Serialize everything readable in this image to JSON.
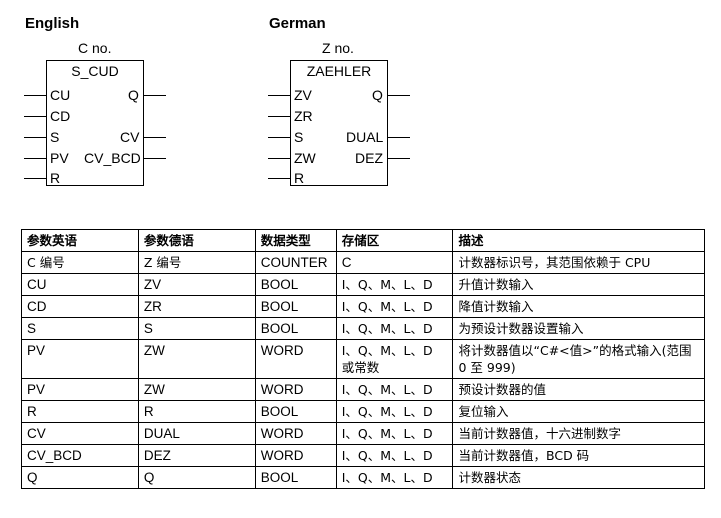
{
  "english": {
    "heading": "English",
    "cno": "C no.",
    "block_title": "S_CUD",
    "left_pins": [
      "CU",
      "CD",
      "S",
      "PV",
      "R"
    ],
    "right_pins": [
      "Q",
      "CV",
      "CV_BCD"
    ]
  },
  "german": {
    "heading": "German",
    "cno": "Z no.",
    "block_title": "ZAEHLER",
    "left_pins": [
      "ZV",
      "ZR",
      "S",
      "ZW",
      "R"
    ],
    "right_pins": [
      "Q",
      "DUAL",
      "DEZ"
    ]
  },
  "table": {
    "headers": [
      "参数英语",
      "参数德语",
      "数据类型",
      "存储区",
      "描述"
    ],
    "rows": [
      [
        "C 编号",
        "Z 编号",
        "COUNTER",
        "C",
        "计数器标识号，其范围依赖于 CPU"
      ],
      [
        "CU",
        "ZV",
        "BOOL",
        "I、Q、M、L、D",
        "升值计数输入"
      ],
      [
        "CD",
        "ZR",
        "BOOL",
        "I、Q、M、L、D",
        "降值计数输入"
      ],
      [
        "S",
        "S",
        "BOOL",
        "I、Q、M、L、D",
        "为预设计数器设置输入"
      ],
      [
        "PV",
        "ZW",
        "WORD",
        "I、Q、M、L、D 或常数",
        "将计数器值以“C#<值>”的格式输入(范围 0 至 999)"
      ],
      [
        "PV",
        "ZW",
        "WORD",
        "I、Q、M、L、D",
        "预设计数器的值"
      ],
      [
        "R",
        "R",
        "BOOL",
        "I、Q、M、L、D",
        "复位输入"
      ],
      [
        "CV",
        "DUAL",
        "WORD",
        "I、Q、M、L、D",
        "当前计数器值，十六进制数字"
      ],
      [
        "CV_BCD",
        "DEZ",
        "WORD",
        "I、Q、M、L、D",
        "当前计数器值，BCD 码"
      ],
      [
        "Q",
        "Q",
        "BOOL",
        "I、Q、M、L、D",
        "计数器状态"
      ]
    ]
  }
}
